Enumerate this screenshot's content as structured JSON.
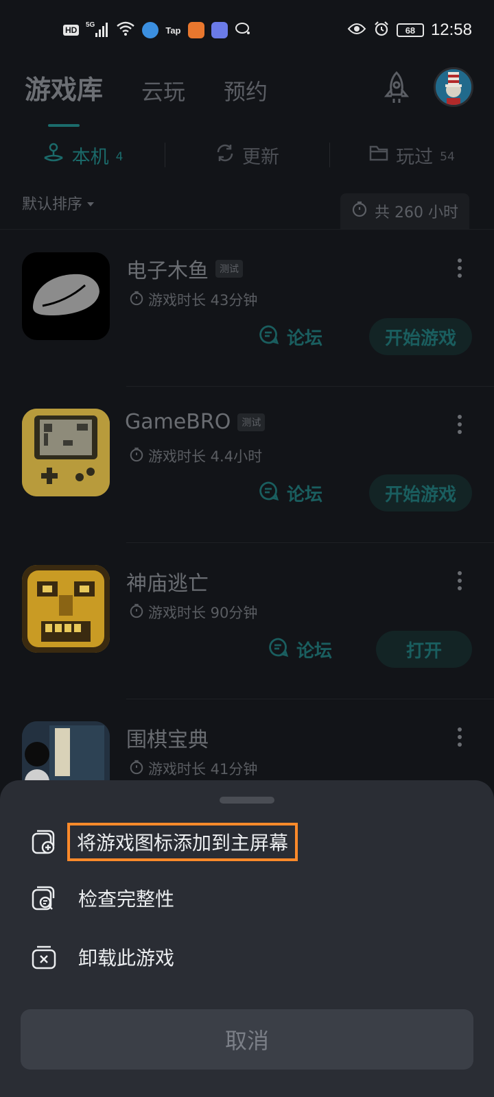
{
  "status_bar": {
    "hd": "HD",
    "network": "5G",
    "tap_label": "Tap",
    "battery": "68",
    "time": "12:58",
    "icons": [
      "hd-icon",
      "signal-icon",
      "wifi-icon",
      "app-icon-blue",
      "tap-app-icon",
      "app-icon-orange",
      "music-app-icon",
      "chat-icon",
      "eye-icon",
      "alarm-icon",
      "battery-icon"
    ]
  },
  "header": {
    "tabs": [
      {
        "label": "游戏库",
        "active": true
      },
      {
        "label": "云玩",
        "active": false
      },
      {
        "label": "预约",
        "active": false
      }
    ]
  },
  "sub_tabs": [
    {
      "label": "本机",
      "count": "4",
      "icon": "joystick-icon",
      "active": true
    },
    {
      "label": "更新",
      "count": "",
      "icon": "refresh-icon",
      "active": false
    },
    {
      "label": "玩过",
      "count": "54",
      "icon": "folder-icon",
      "active": false
    }
  ],
  "sort": {
    "label": "默认排序"
  },
  "total_time": {
    "label": "共 260 小时"
  },
  "games": [
    {
      "name": "电子木鱼",
      "tag": "测试",
      "playtime": "游戏时长 43分钟",
      "forum": "论坛",
      "action": "开始游戏"
    },
    {
      "name": "GameBRO",
      "tag": "测试",
      "playtime": "游戏时长 4.4小时",
      "forum": "论坛",
      "action": "开始游戏"
    },
    {
      "name": "神庙逃亡",
      "tag": "",
      "playtime": "游戏时长 90分钟",
      "forum": "论坛",
      "action": "打开"
    },
    {
      "name": "围棋宝典",
      "tag": "",
      "playtime": "游戏时长 41分钟",
      "forum": "",
      "action": ""
    }
  ],
  "sheet": {
    "items": [
      {
        "label": "将游戏图标添加到主屏幕",
        "icon": "add-to-home-icon",
        "highlighted": true
      },
      {
        "label": "检查完整性",
        "icon": "check-integrity-icon",
        "highlighted": false
      },
      {
        "label": "卸载此游戏",
        "icon": "uninstall-icon",
        "highlighted": false
      }
    ],
    "cancel": "取消"
  },
  "colors": {
    "background": "#121418",
    "accent": "#1b6a6a",
    "sheet": "#2a2d34",
    "highlight": "#ff8a2a"
  }
}
